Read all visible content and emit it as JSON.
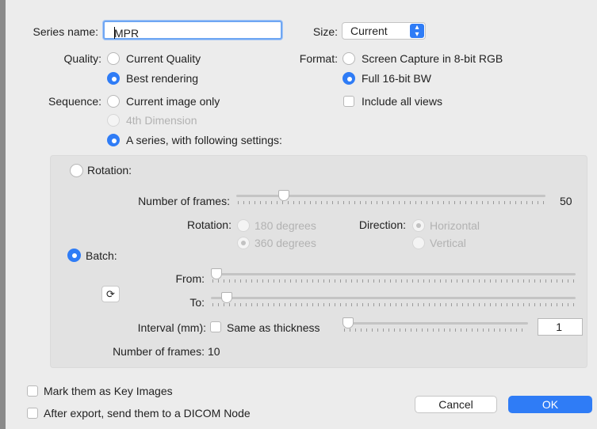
{
  "series_name": {
    "label": "Series name:",
    "value": "MPR"
  },
  "size": {
    "label": "Size:",
    "value": "Current"
  },
  "quality": {
    "label": "Quality:",
    "options": [
      "Current Quality",
      "Best rendering"
    ],
    "selected": "Best rendering"
  },
  "format": {
    "label": "Format:",
    "options": [
      "Screen Capture in 8-bit RGB",
      "Full 16-bit BW"
    ],
    "selected": "Full 16-bit BW"
  },
  "sequence": {
    "label": "Sequence:",
    "options": [
      "Current image only",
      "4th Dimension",
      "A series, with following settings:"
    ],
    "selected": "A series, with following settings:"
  },
  "include_all_views": {
    "label": "Include all views",
    "checked": false
  },
  "rotation_mode": {
    "label": "Rotation:",
    "frames_label": "Number of frames:",
    "frames_value": "50",
    "frames_fraction": 0.14,
    "rotation_label": "Rotation:",
    "rotation_options": [
      "180 degrees",
      "360 degrees"
    ],
    "rotation_selected": "360 degrees",
    "direction_label": "Direction:",
    "direction_options": [
      "Horizontal",
      "Vertical"
    ],
    "direction_selected": "Horizontal"
  },
  "batch_mode": {
    "label": "Batch:",
    "from_label": "From:",
    "to_label": "To:",
    "from_fraction": 0.0,
    "to_fraction": 0.03,
    "interval_label": "Interval (mm):",
    "same_as_thickness_label": "Same as thickness",
    "interval_fraction": 0.0,
    "interval_value": "1",
    "frames_label": "Number of frames:",
    "frames_value": "10"
  },
  "mark_key_images": {
    "label": "Mark them as Key Images",
    "checked": false
  },
  "send_dicom": {
    "label": "After export, send them to a DICOM Node",
    "checked": false
  },
  "buttons": {
    "cancel": "Cancel",
    "ok": "OK"
  },
  "icons": {
    "reset": "reset-icon",
    "select_arrows": "chevron-up-down-icon"
  },
  "colors": {
    "accent": "#2f7cf6",
    "background": "#ececec",
    "panel": "#e2e2e2"
  }
}
